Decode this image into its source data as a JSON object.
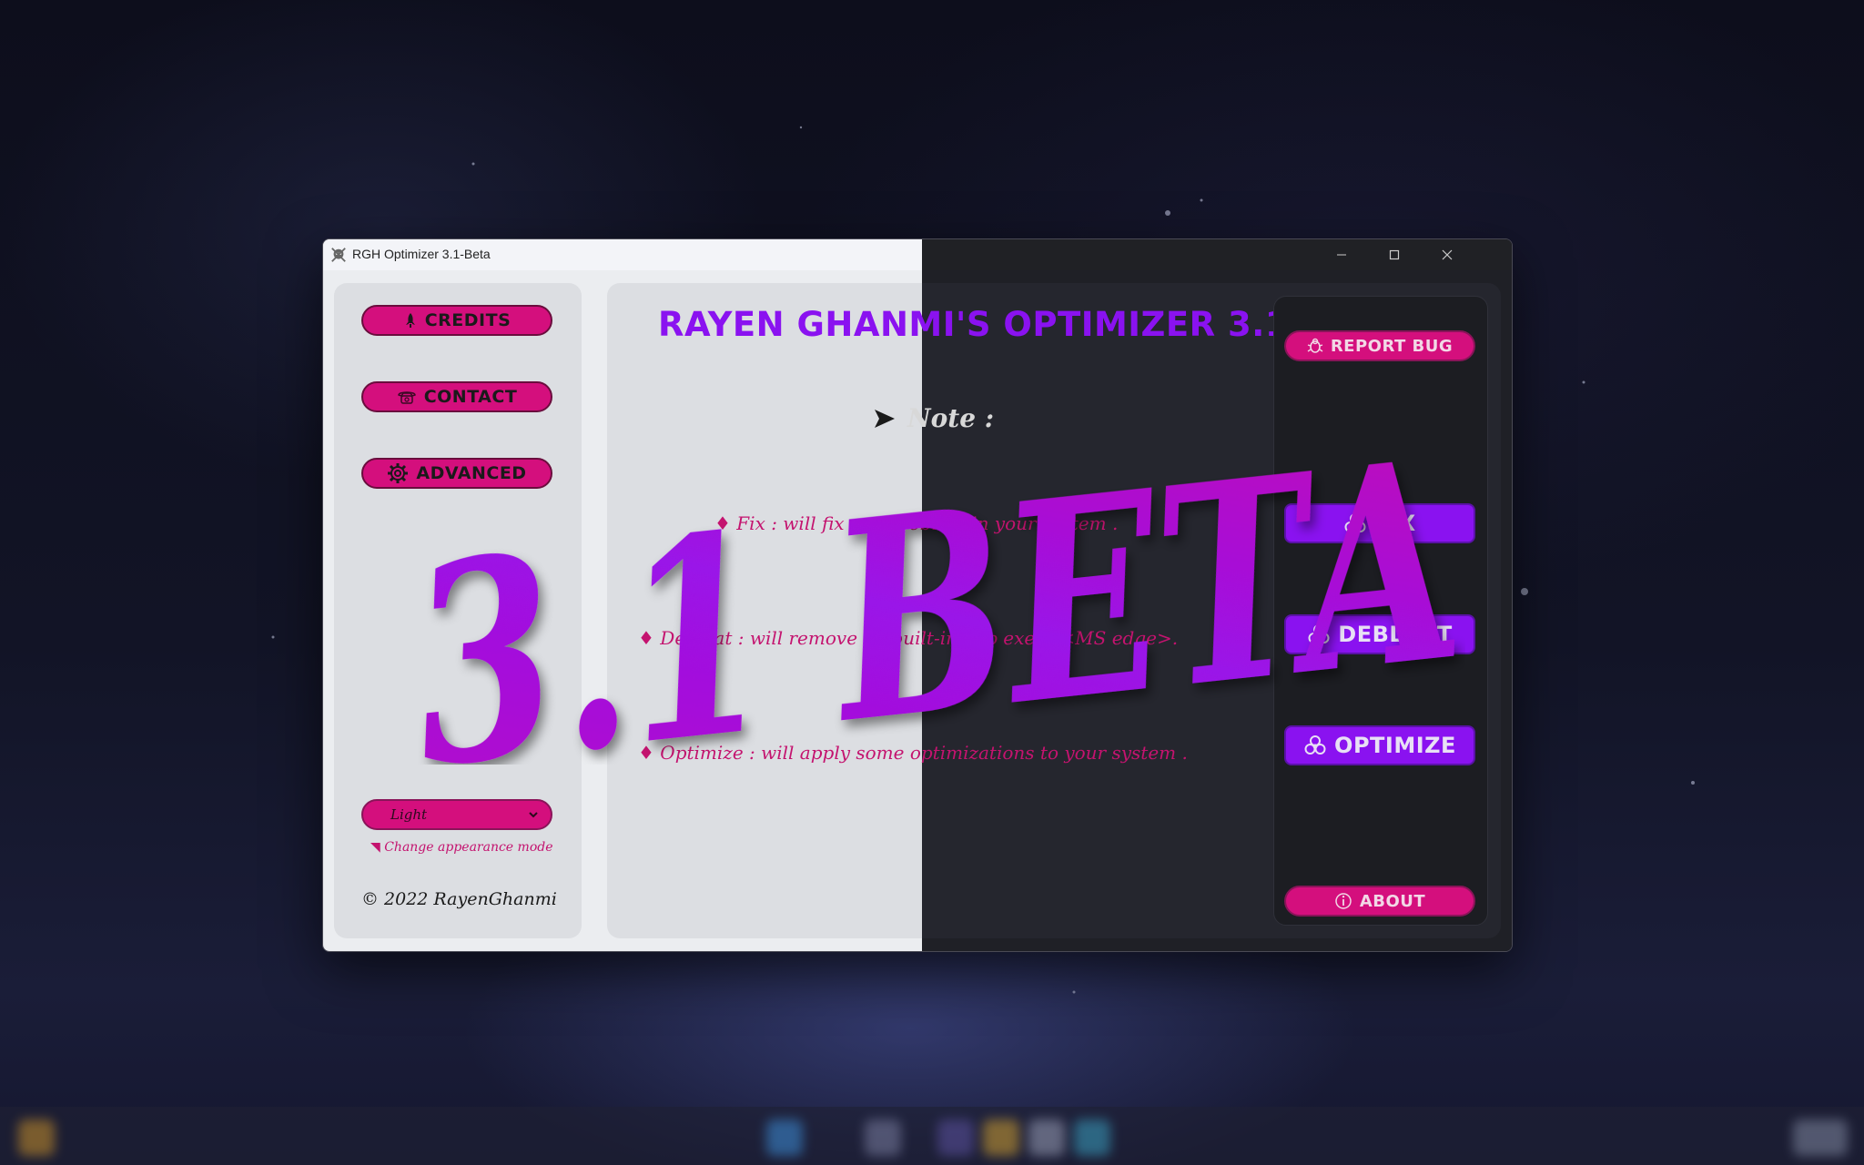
{
  "window": {
    "title": "RGH Optimizer 3.1-Beta"
  },
  "sidebar": {
    "credits_label": "CREDITS",
    "contact_label": "CONTACT",
    "advanced_label": "ADVANCED",
    "appearance": {
      "selected": "Light",
      "options": [
        "Light"
      ],
      "hint": "Change appearance mode"
    },
    "copyright": "© 2022 RayenGhanmi"
  },
  "main": {
    "title": "RAYEN GHANMI'S OPTIMIZER 3.1",
    "note_label": "Note :",
    "lines": [
      {
        "bullet": "♦",
        "text": "Fix : will fix any problem in your system ."
      },
      {
        "bullet": "♦",
        "text": "Debloat : will remove all built-in app exept <MS edge>."
      },
      {
        "bullet": "♦",
        "text": "Optimize : will apply some optimizations to your system ."
      }
    ]
  },
  "actions": {
    "report_bug_label": "REPORT BUG",
    "fix_label": "FIX",
    "debloat_label": "DEBLOAT",
    "optimize_label": "OPTIMIZE",
    "about_label": "ABOUT"
  },
  "overlay": {
    "text": "3.1 BETA"
  },
  "colors": {
    "accent_pink": "#d40f7d",
    "accent_purple": "#8a12f0",
    "panel_light": "#dcdee2",
    "panel_dark": "#25262e"
  }
}
